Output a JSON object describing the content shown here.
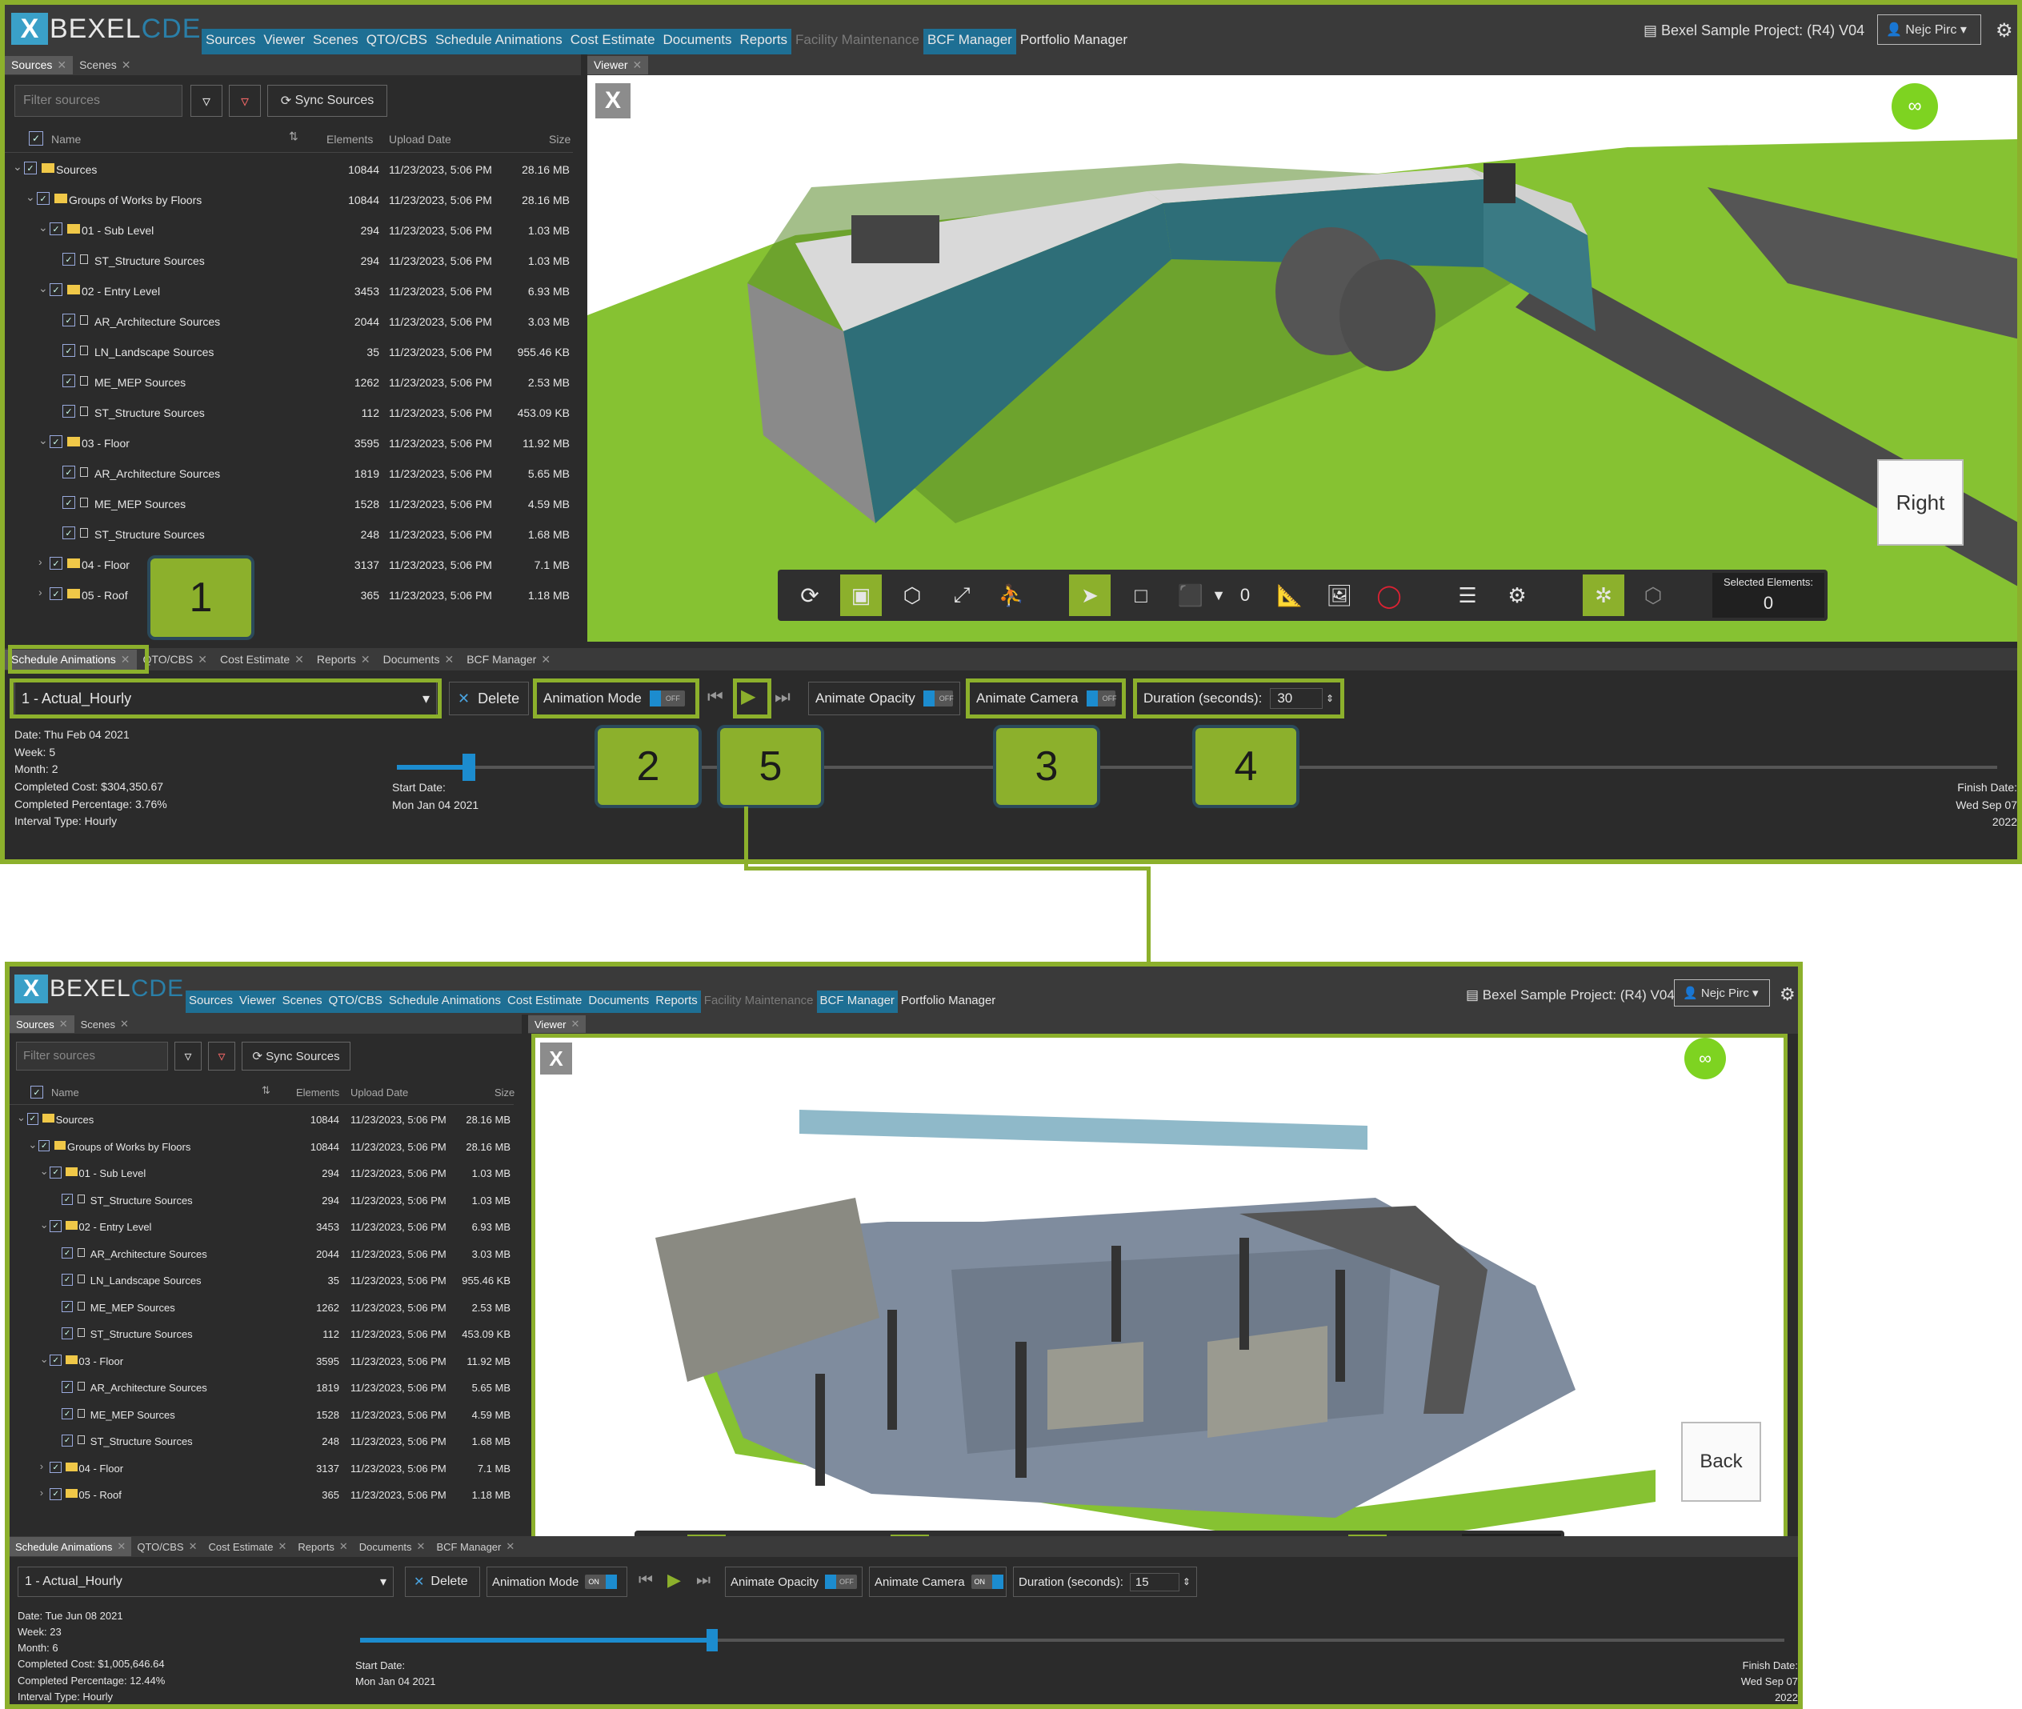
{
  "app": {
    "logo_x": "X",
    "logo_text": "BEXEL",
    "logo_cde": "CDE"
  },
  "menu": [
    "Sources",
    "Viewer",
    "Scenes",
    "QTO/CBS",
    "Schedule Animations",
    "Cost Estimate",
    "Documents",
    "Reports",
    "Facility Maintenance",
    "BCF Manager",
    "Portfolio Manager"
  ],
  "project": "Bexel Sample Project: (R4) V04",
  "user": "Nejc Pirc",
  "left_tabs": [
    "Sources",
    "Scenes"
  ],
  "viewer_tab": "Viewer",
  "filter_placeholder": "Filter sources",
  "sync_label": "Sync Sources",
  "columns": {
    "name": "Name",
    "elements": "Elements",
    "date": "Upload Date",
    "size": "Size"
  },
  "sources": [
    {
      "name": "Sources",
      "elements": "10844",
      "date": "11/23/2023, 5:06 PM",
      "size": "28.16 MB"
    },
    {
      "name": "Groups of Works by Floors",
      "elements": "10844",
      "date": "11/23/2023, 5:06 PM",
      "size": "28.16 MB"
    },
    {
      "name": "01 - Sub Level",
      "elements": "294",
      "date": "11/23/2023, 5:06 PM",
      "size": "1.03 MB"
    },
    {
      "name": "ST_Structure Sources",
      "elements": "294",
      "date": "11/23/2023, 5:06 PM",
      "size": "1.03 MB"
    },
    {
      "name": "02 - Entry Level",
      "elements": "3453",
      "date": "11/23/2023, 5:06 PM",
      "size": "6.93 MB"
    },
    {
      "name": "AR_Architecture Sources",
      "elements": "2044",
      "date": "11/23/2023, 5:06 PM",
      "size": "3.03 MB"
    },
    {
      "name": "LN_Landscape Sources",
      "elements": "35",
      "date": "11/23/2023, 5:06 PM",
      "size": "955.46 KB"
    },
    {
      "name": "ME_MEP Sources",
      "elements": "1262",
      "date": "11/23/2023, 5:06 PM",
      "size": "2.53 MB"
    },
    {
      "name": "ST_Structure Sources",
      "elements": "112",
      "date": "11/23/2023, 5:06 PM",
      "size": "453.09 KB"
    },
    {
      "name": "03 - Floor",
      "elements": "3595",
      "date": "11/23/2023, 5:06 PM",
      "size": "11.92 MB"
    },
    {
      "name": "AR_Architecture Sources",
      "elements": "1819",
      "date": "11/23/2023, 5:06 PM",
      "size": "5.65 MB"
    },
    {
      "name": "ME_MEP Sources",
      "elements": "1528",
      "date": "11/23/2023, 5:06 PM",
      "size": "4.59 MB"
    },
    {
      "name": "ST_Structure Sources",
      "elements": "248",
      "date": "11/23/2023, 5:06 PM",
      "size": "1.68 MB"
    },
    {
      "name": "04 - Floor",
      "elements": "3137",
      "date": "11/23/2023, 5:06 PM",
      "size": "7.1 MB"
    },
    {
      "name": "05 - Roof",
      "elements": "365",
      "date": "11/23/2023, 5:06 PM",
      "size": "1.18 MB"
    }
  ],
  "bottom_tabs": [
    "Schedule Animations",
    "QTO/CBS",
    "Cost Estimate",
    "Reports",
    "Documents",
    "BCF Manager"
  ],
  "schedule_select": "1 - Actual_Hourly",
  "delete_label": "Delete",
  "animation_mode_label": "Animation Mode",
  "animate_opacity_label": "Animate Opacity",
  "animate_camera_label": "Animate Camera",
  "duration_label": "Duration (seconds):",
  "start_date_label": "Start Date:",
  "start_date": "Mon Jan 04 2021",
  "finish_date_label": "Finish Date:",
  "finish_date": "Wed Sep 07 2022",
  "selected_label": "Selected Elements:",
  "selected_value": "0",
  "toolbar_count": "0",
  "toggle_off": "OFF",
  "toggle_on": "ON",
  "shot1": {
    "duration": "30",
    "navcube": "Right",
    "progress": 0.045,
    "info": [
      "Date: Thu Feb 04 2021",
      "Week: 5",
      "Month: 2",
      "Completed Cost: $304,350.67",
      "Completed Percentage: 3.76%",
      "Interval Type: Hourly"
    ]
  },
  "shot2": {
    "duration": "15",
    "navcube": "Back",
    "progress": 0.247,
    "info": [
      "Date: Tue Jun 08 2021",
      "Week: 23",
      "Month: 6",
      "Completed Cost: $1,005,646.64",
      "Completed Percentage: 12.44%",
      "Interval Type: Hourly"
    ]
  },
  "callouts": [
    "1",
    "2",
    "3",
    "4",
    "5"
  ],
  "colors": {
    "accent": "#8cb02c",
    "menu_bg": "#1e6f94",
    "slider": "#1c8ccf",
    "grass": "#86c232"
  }
}
